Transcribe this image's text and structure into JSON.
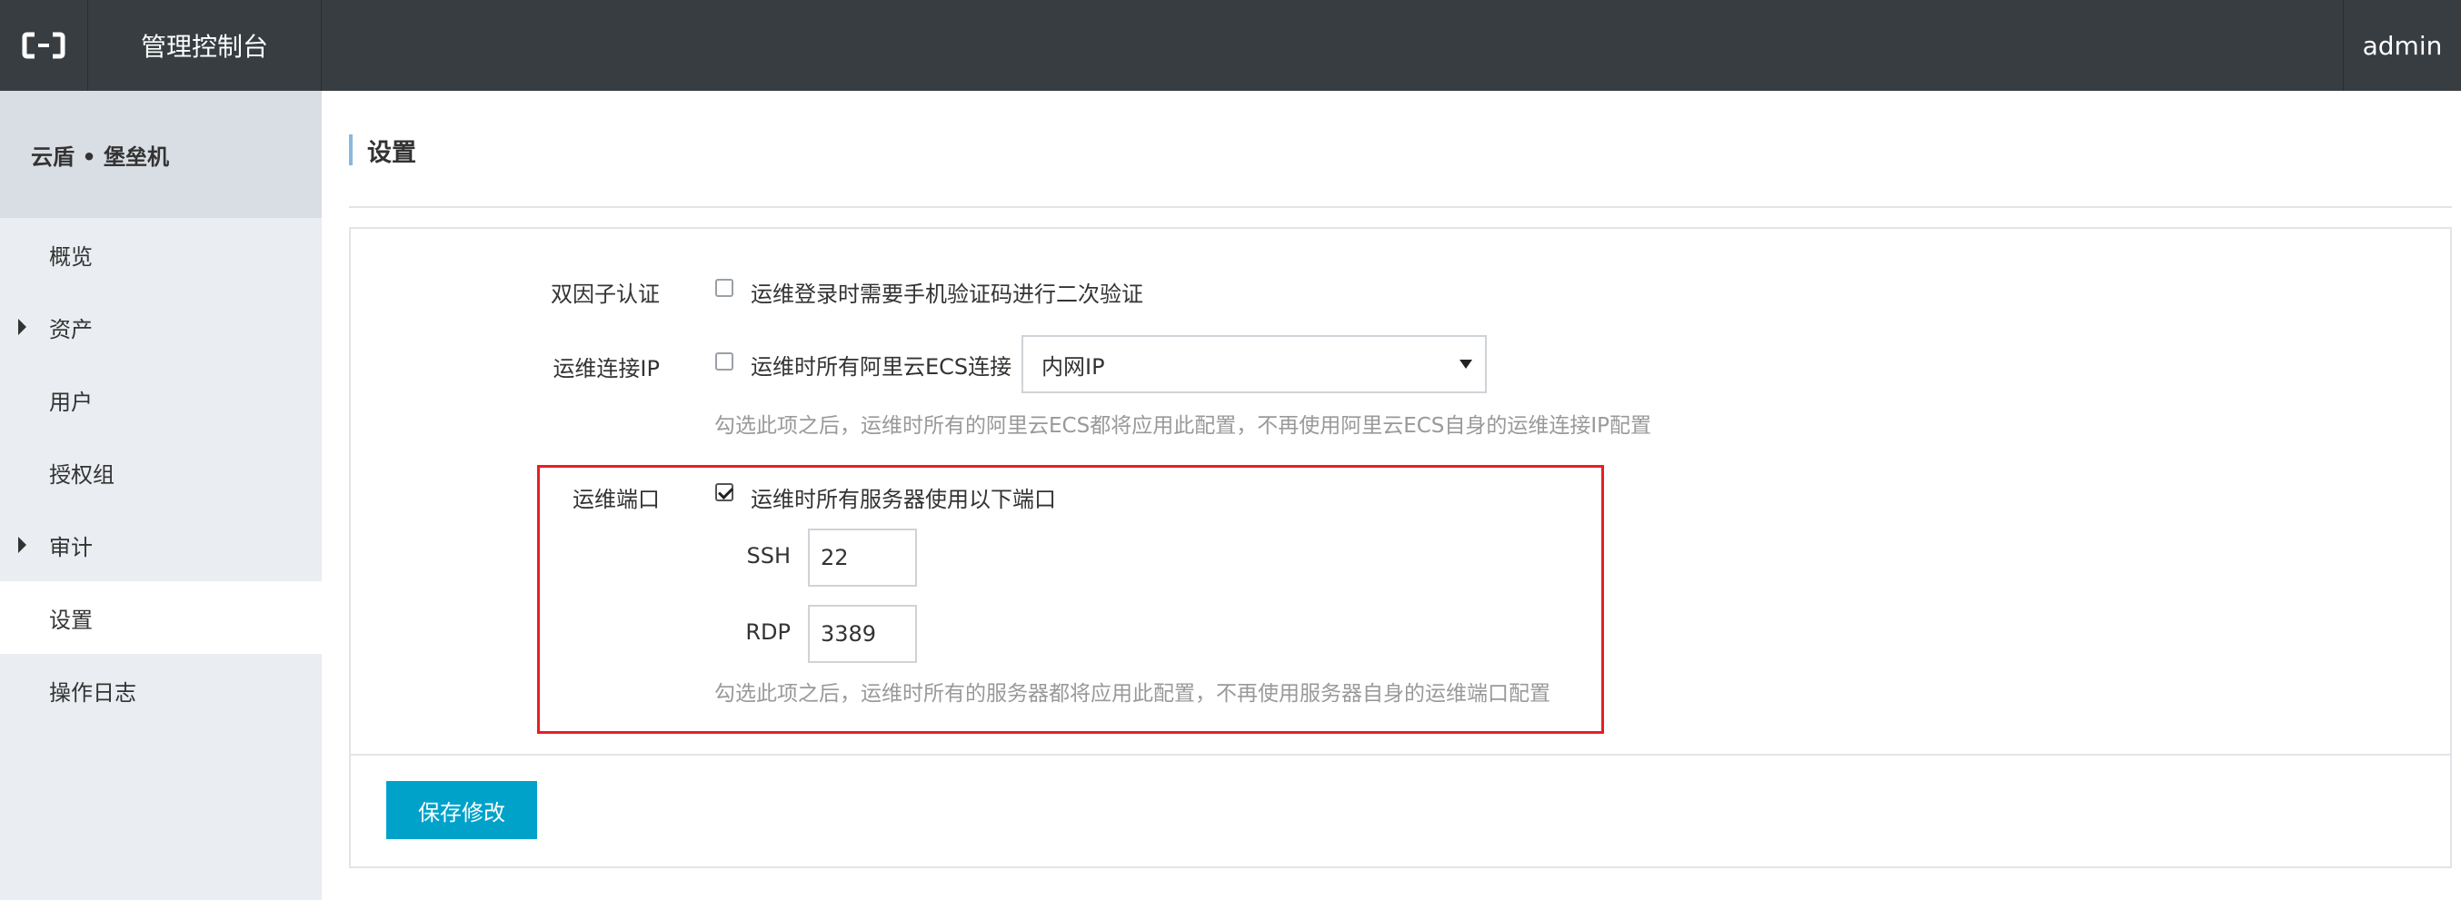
{
  "header": {
    "logo_icon": "aliyun-logo-icon",
    "brand": "管理控制台",
    "user": "admin"
  },
  "sidebar": {
    "product": "云盾 • 堡垒机",
    "items": [
      {
        "label": "概览",
        "expandable": false,
        "active": false
      },
      {
        "label": "资产",
        "expandable": true,
        "active": false
      },
      {
        "label": "用户",
        "expandable": false,
        "active": false
      },
      {
        "label": "授权组",
        "expandable": false,
        "active": false
      },
      {
        "label": "审计",
        "expandable": true,
        "active": false
      },
      {
        "label": "设置",
        "expandable": false,
        "active": true
      },
      {
        "label": "操作日志",
        "expandable": false,
        "active": false
      }
    ]
  },
  "page": {
    "title": "设置"
  },
  "settings": {
    "two_factor": {
      "label": "双因子认证",
      "checkbox_text": "运维登录时需要手机验证码进行二次验证",
      "checked": false
    },
    "connect_ip": {
      "label": "运维连接IP",
      "checkbox_text": "运维时所有阿里云ECS连接",
      "checked": false,
      "select_value": "内网IP",
      "hint": "勾选此项之后，运维时所有的阿里云ECS都将应用此配置，不再使用阿里云ECS自身的运维连接IP配置"
    },
    "ports": {
      "label": "运维端口",
      "checkbox_text": "运维时所有服务器使用以下端口",
      "checked": true,
      "ssh_label": "SSH",
      "ssh_value": "22",
      "rdp_label": "RDP",
      "rdp_value": "3389",
      "hint": "勾选此项之后，运维时所有的服务器都将应用此配置，不再使用服务器自身的运维端口配置"
    }
  },
  "actions": {
    "save_label": "保存修改"
  },
  "colors": {
    "topbar": "#373d41",
    "sidebar": "#eaedf1",
    "primary": "#00a2ca",
    "highlight": "#e81e25"
  }
}
